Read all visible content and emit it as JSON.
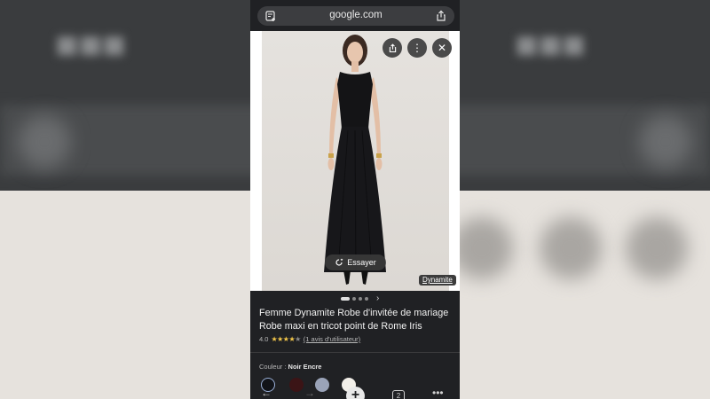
{
  "browser": {
    "url": "google.com"
  },
  "image_viewer": {
    "try_on_label": "Essayer",
    "source_label": "Dynamite",
    "carousel": {
      "count": 4,
      "active_index": 0
    }
  },
  "product": {
    "title": "Femme Dynamite Robe d'invitée de mariage Robe maxi en tricot point de Rome Iris",
    "rating_value": "4.0",
    "rating_stars": 4,
    "reviews_label": "(1 avis d'utilisateur)",
    "color_label": "Couleur :",
    "color_value": "Noir Encre",
    "swatches": [
      "#111318",
      "#3b1416",
      "#9aa3b8",
      "#f2efe9"
    ]
  },
  "toolbar": {
    "tab_count": "2"
  }
}
